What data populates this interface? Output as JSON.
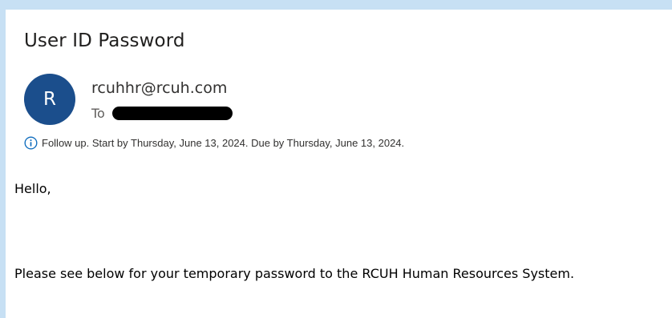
{
  "message": {
    "subject": "User ID Password",
    "sender_initial": "R",
    "sender": "rcuhhr@rcuh.com",
    "to_label": "To",
    "followup": "Follow up.  Start by Thursday, June 13, 2024.  Due by Thursday, June 13, 2024.",
    "greeting": "Hello,",
    "body_line": "Please see below for your temporary password to the RCUH Human Resources System."
  },
  "colors": {
    "background": "#c7e0f4",
    "avatar": "#1b4e8c",
    "info_icon": "#0f6cbd"
  },
  "icons": {
    "followup": "info-icon"
  }
}
